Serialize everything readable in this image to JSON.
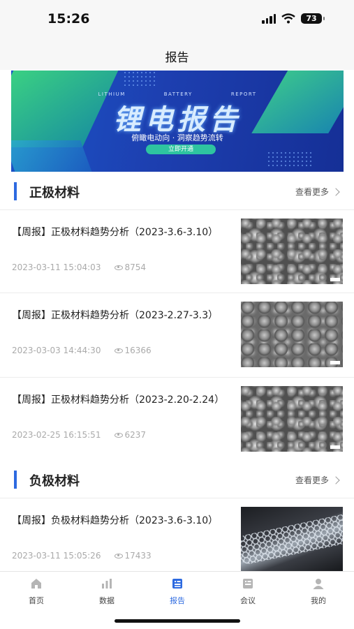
{
  "status": {
    "time": "15:26",
    "battery": "73"
  },
  "header": {
    "title": "报告"
  },
  "banner": {
    "subtitle_words": [
      "LITHIUM",
      "BATTERY",
      "REPORT"
    ],
    "title": "锂电报告",
    "tagline": "俯瞰电动向 · 洞察趋势流转",
    "button": "立即开通"
  },
  "sections": [
    {
      "title": "正极材料",
      "more": "查看更多",
      "items": [
        {
          "title": "【周报】正极材料趋势分析（2023-3.6-3.10）",
          "date": "2023-03-11 15:04:03",
          "views": "8754",
          "thumb": "sem-particles"
        },
        {
          "title": "【周报】正极材料趋势分析（2023-2.27-3.3）",
          "date": "2023-03-03 14:44:30",
          "views": "16366",
          "thumb": "sem-particles"
        },
        {
          "title": "【周报】正极材料趋势分析（2023-2.20-2.24）",
          "date": "2023-02-25 16:15:51",
          "views": "6237",
          "thumb": "sem-particles"
        }
      ]
    },
    {
      "title": "负极材料",
      "more": "查看更多",
      "items": [
        {
          "title": "【周报】负极材料趋势分析（2023-3.6-3.10）",
          "date": "2023-03-11 15:05:26",
          "views": "17433",
          "thumb": "carbon-nanotube"
        }
      ]
    }
  ],
  "tabbar": {
    "items": [
      {
        "label": "首页",
        "icon": "home-icon"
      },
      {
        "label": "数据",
        "icon": "chart-icon"
      },
      {
        "label": "报告",
        "icon": "report-icon",
        "active": true
      },
      {
        "label": "会议",
        "icon": "meeting-icon"
      },
      {
        "label": "我的",
        "icon": "user-icon"
      }
    ]
  },
  "colors": {
    "accent": "#2d6ae0",
    "banner_bg": "#1d3fb0",
    "muted": "#aaaaaa"
  }
}
